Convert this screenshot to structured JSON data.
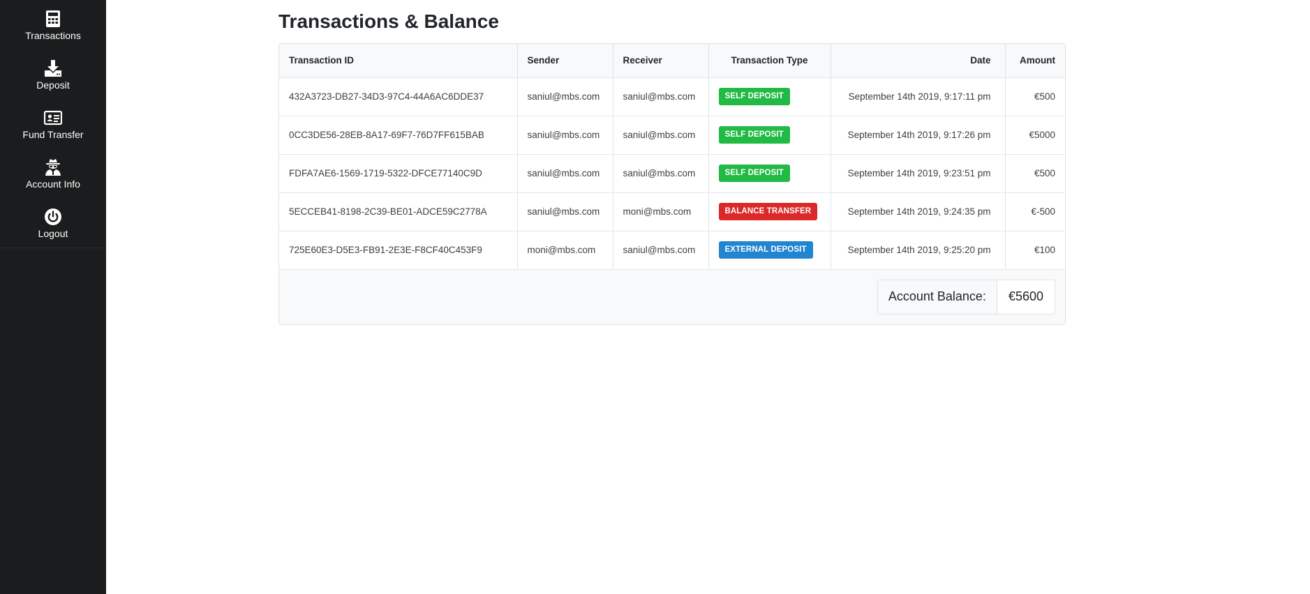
{
  "sidebar": {
    "items": [
      {
        "label": "Transactions",
        "icon": "calculator-icon"
      },
      {
        "label": "Deposit",
        "icon": "download-icon"
      },
      {
        "label": "Fund Transfer",
        "icon": "id-card-icon"
      },
      {
        "label": "Account Info",
        "icon": "user-secret-icon"
      },
      {
        "label": "Logout",
        "icon": "power-icon"
      }
    ]
  },
  "page": {
    "title": "Transactions & Balance"
  },
  "table": {
    "headers": {
      "id": "Transaction ID",
      "sender": "Sender",
      "receiver": "Receiver",
      "type": "Transaction Type",
      "date": "Date",
      "amount": "Amount"
    },
    "rows": [
      {
        "id": "432A3723-DB27-34D3-97C4-44A6AC6DDE37",
        "sender": "saniul@mbs.com",
        "receiver": "saniul@mbs.com",
        "type": "SELF DEPOSIT",
        "type_color": "#21ba45",
        "date": "September 14th 2019, 9:17:11 pm",
        "amount": "€500"
      },
      {
        "id": "0CC3DE56-28EB-8A17-69F7-76D7FF615BAB",
        "sender": "saniul@mbs.com",
        "receiver": "saniul@mbs.com",
        "type": "SELF DEPOSIT",
        "type_color": "#21ba45",
        "date": "September 14th 2019, 9:17:26 pm",
        "amount": "€5000"
      },
      {
        "id": "FDFA7AE6-1569-1719-5322-DFCE77140C9D",
        "sender": "saniul@mbs.com",
        "receiver": "saniul@mbs.com",
        "type": "SELF DEPOSIT",
        "type_color": "#21ba45",
        "date": "September 14th 2019, 9:23:51 pm",
        "amount": "€500"
      },
      {
        "id": "5ECCEB41-8198-2C39-BE01-ADCE59C2778A",
        "sender": "saniul@mbs.com",
        "receiver": "moni@mbs.com",
        "type": "BALANCE TRANSFER",
        "type_color": "#db2828",
        "date": "September 14th 2019, 9:24:35 pm",
        "amount": "€-500"
      },
      {
        "id": "725E60E3-D5E3-FB91-2E3E-F8CF40C453F9",
        "sender": "moni@mbs.com",
        "receiver": "saniul@mbs.com",
        "type": "EXTERNAL DEPOSIT",
        "type_color": "#2185d0",
        "date": "September 14th 2019, 9:25:20 pm",
        "amount": "€100"
      }
    ]
  },
  "balance": {
    "label": "Account Balance:",
    "value": "€5600"
  }
}
